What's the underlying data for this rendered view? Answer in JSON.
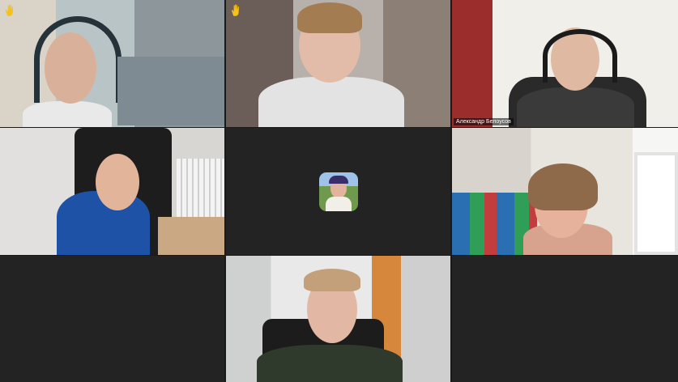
{
  "meeting": {
    "participants": [
      {
        "name": "",
        "raised_hand": true,
        "video": true
      },
      {
        "name": "",
        "raised_hand": true,
        "video": true
      },
      {
        "name": "Александр Белоусов",
        "raised_hand": false,
        "video": true,
        "speaking": true
      },
      {
        "name": "",
        "raised_hand": false,
        "video": true
      },
      {
        "name": "",
        "raised_hand": false,
        "video": false,
        "avatar": "profile-photo"
      },
      {
        "name": "",
        "raised_hand": false,
        "video": true
      },
      {
        "name": "",
        "raised_hand": false,
        "video": true
      }
    ]
  },
  "colors": {
    "active_speaker_border": "#23d959",
    "empty_tile": "#232323",
    "background": "#1a1a1a"
  },
  "icons": [
    "raised-hand-icon"
  ]
}
